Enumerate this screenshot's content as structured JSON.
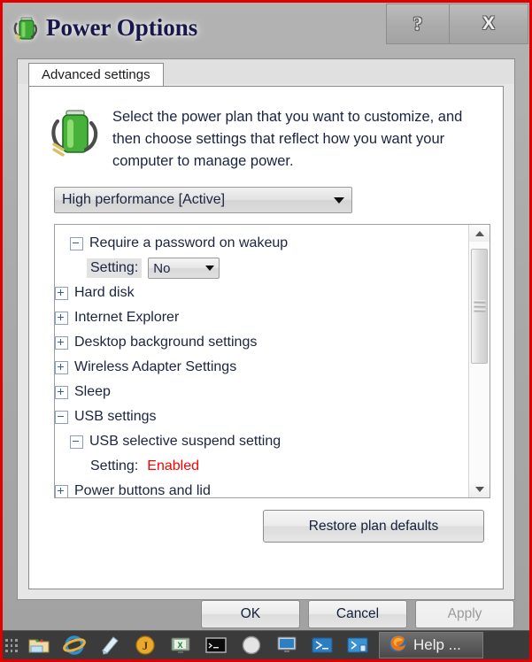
{
  "window": {
    "title": "Power Options",
    "icon": "battery-plug-icon",
    "caption_buttons": [
      {
        "name": "help-button",
        "glyph": "?"
      },
      {
        "name": "close-button",
        "glyph": "X"
      }
    ]
  },
  "tabs": [
    {
      "label": "Advanced settings",
      "selected": true
    }
  ],
  "blurb": {
    "icon": "battery-plug-icon",
    "text": "Select the power plan that you want to customize, and then choose settings that reflect how you want your computer to manage power."
  },
  "plan_combo": {
    "value": "High performance [Active]",
    "arrow": "chevron-down-icon"
  },
  "settings_list": [
    {
      "indent": 1,
      "expander": "minus",
      "label": "Require a password on wakeup"
    },
    {
      "indent": 2,
      "type": "setting-combo",
      "label": "Setting:",
      "value": "No",
      "highlight": true
    },
    {
      "indent": 0,
      "expander": "plus",
      "label": "Hard disk"
    },
    {
      "indent": 0,
      "expander": "plus",
      "label": "Internet Explorer"
    },
    {
      "indent": 0,
      "expander": "plus",
      "label": "Desktop background settings"
    },
    {
      "indent": 0,
      "expander": "plus",
      "label": "Wireless Adapter Settings"
    },
    {
      "indent": 0,
      "expander": "plus",
      "label": "Sleep"
    },
    {
      "indent": 0,
      "expander": "minus",
      "label": "USB settings"
    },
    {
      "indent": 1,
      "expander": "minus",
      "label": "USB selective suspend setting"
    },
    {
      "indent": 2,
      "type": "setting-value",
      "label": "Setting:",
      "value": "Enabled",
      "value_color": "#ff0000"
    },
    {
      "indent": 0,
      "expander": "plus",
      "label": "Power buttons and lid"
    }
  ],
  "restore_button": {
    "label": "Restore plan defaults"
  },
  "footer_buttons": [
    {
      "name": "ok-button",
      "label": "OK",
      "disabled": false
    },
    {
      "name": "cancel-button",
      "label": "Cancel",
      "disabled": false
    },
    {
      "name": "apply-button",
      "label": "Apply",
      "disabled": true
    }
  ],
  "taskbar": {
    "icons": [
      "file-explorer-icon",
      "internet-explorer-icon",
      "notepad-icon",
      "java-icon",
      "excel-icon",
      "command-prompt-icon",
      "compass-icon",
      "remote-desktop-icon",
      "powershell-icon",
      "powershell-ise-icon"
    ],
    "task": {
      "icon": "firefox-icon",
      "label": "Help ..."
    }
  },
  "colors": {
    "accent_red": "#ff0000",
    "border_red": "#e00000",
    "title_text": "#17174a",
    "taskbar_bg": "#3b3b3b"
  }
}
